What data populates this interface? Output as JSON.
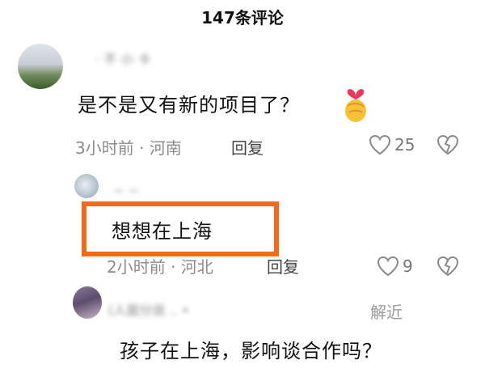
{
  "header": {
    "title": "147条评论"
  },
  "comments": [
    {
      "author": "· 不 小 卡",
      "text": "是不是又有新的项目了？",
      "meta": "3小时前 · 河南",
      "reply": "回复",
      "likes": "25"
    },
    {
      "author": "~ ~",
      "text": "想想在上海",
      "meta": "2小时前 · 河北",
      "reply": "回复",
      "likes": "9"
    },
    {
      "author": "(人面分说 .. •",
      "author_suffix": "解近",
      "text": "孩子在上海，影响谈合作吗？"
    }
  ],
  "colors": {
    "highlight": "#f26a1b",
    "meta": "#8c8c8c"
  },
  "icons": {
    "like": "heart-outline-icon",
    "dislike": "broken-heart-icon",
    "emoji": "hand-heart-emoji"
  }
}
